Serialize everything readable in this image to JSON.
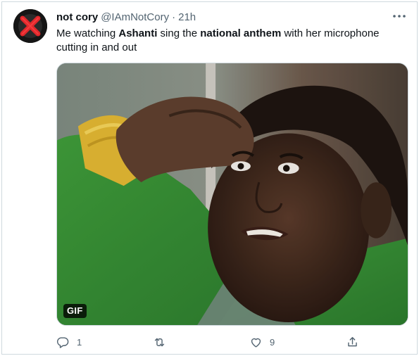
{
  "tweet": {
    "author": {
      "name": "not cory",
      "handle": "@IAmNotCory",
      "separator": "·",
      "time": "21h",
      "avatar_icon": "red-x-icon"
    },
    "text": {
      "part1": "Me watching ",
      "bold1": "Ashanti",
      "part2": " sing the ",
      "bold2": "national anthem",
      "part3": " with her microphone cutting in and out"
    },
    "media": {
      "type": "gif",
      "badge": "GIF"
    },
    "actions": {
      "reply": {
        "icon": "reply-icon",
        "count": "1"
      },
      "retweet": {
        "icon": "retweet-icon",
        "count": ""
      },
      "like": {
        "icon": "heart-icon",
        "count": "9"
      },
      "share": {
        "icon": "share-icon"
      }
    },
    "more_icon": "more-options-icon"
  },
  "colors": {
    "text_primary": "#0f1419",
    "text_secondary": "#536471",
    "border": "#cfd9de",
    "avatar_x": "#e0272b"
  }
}
